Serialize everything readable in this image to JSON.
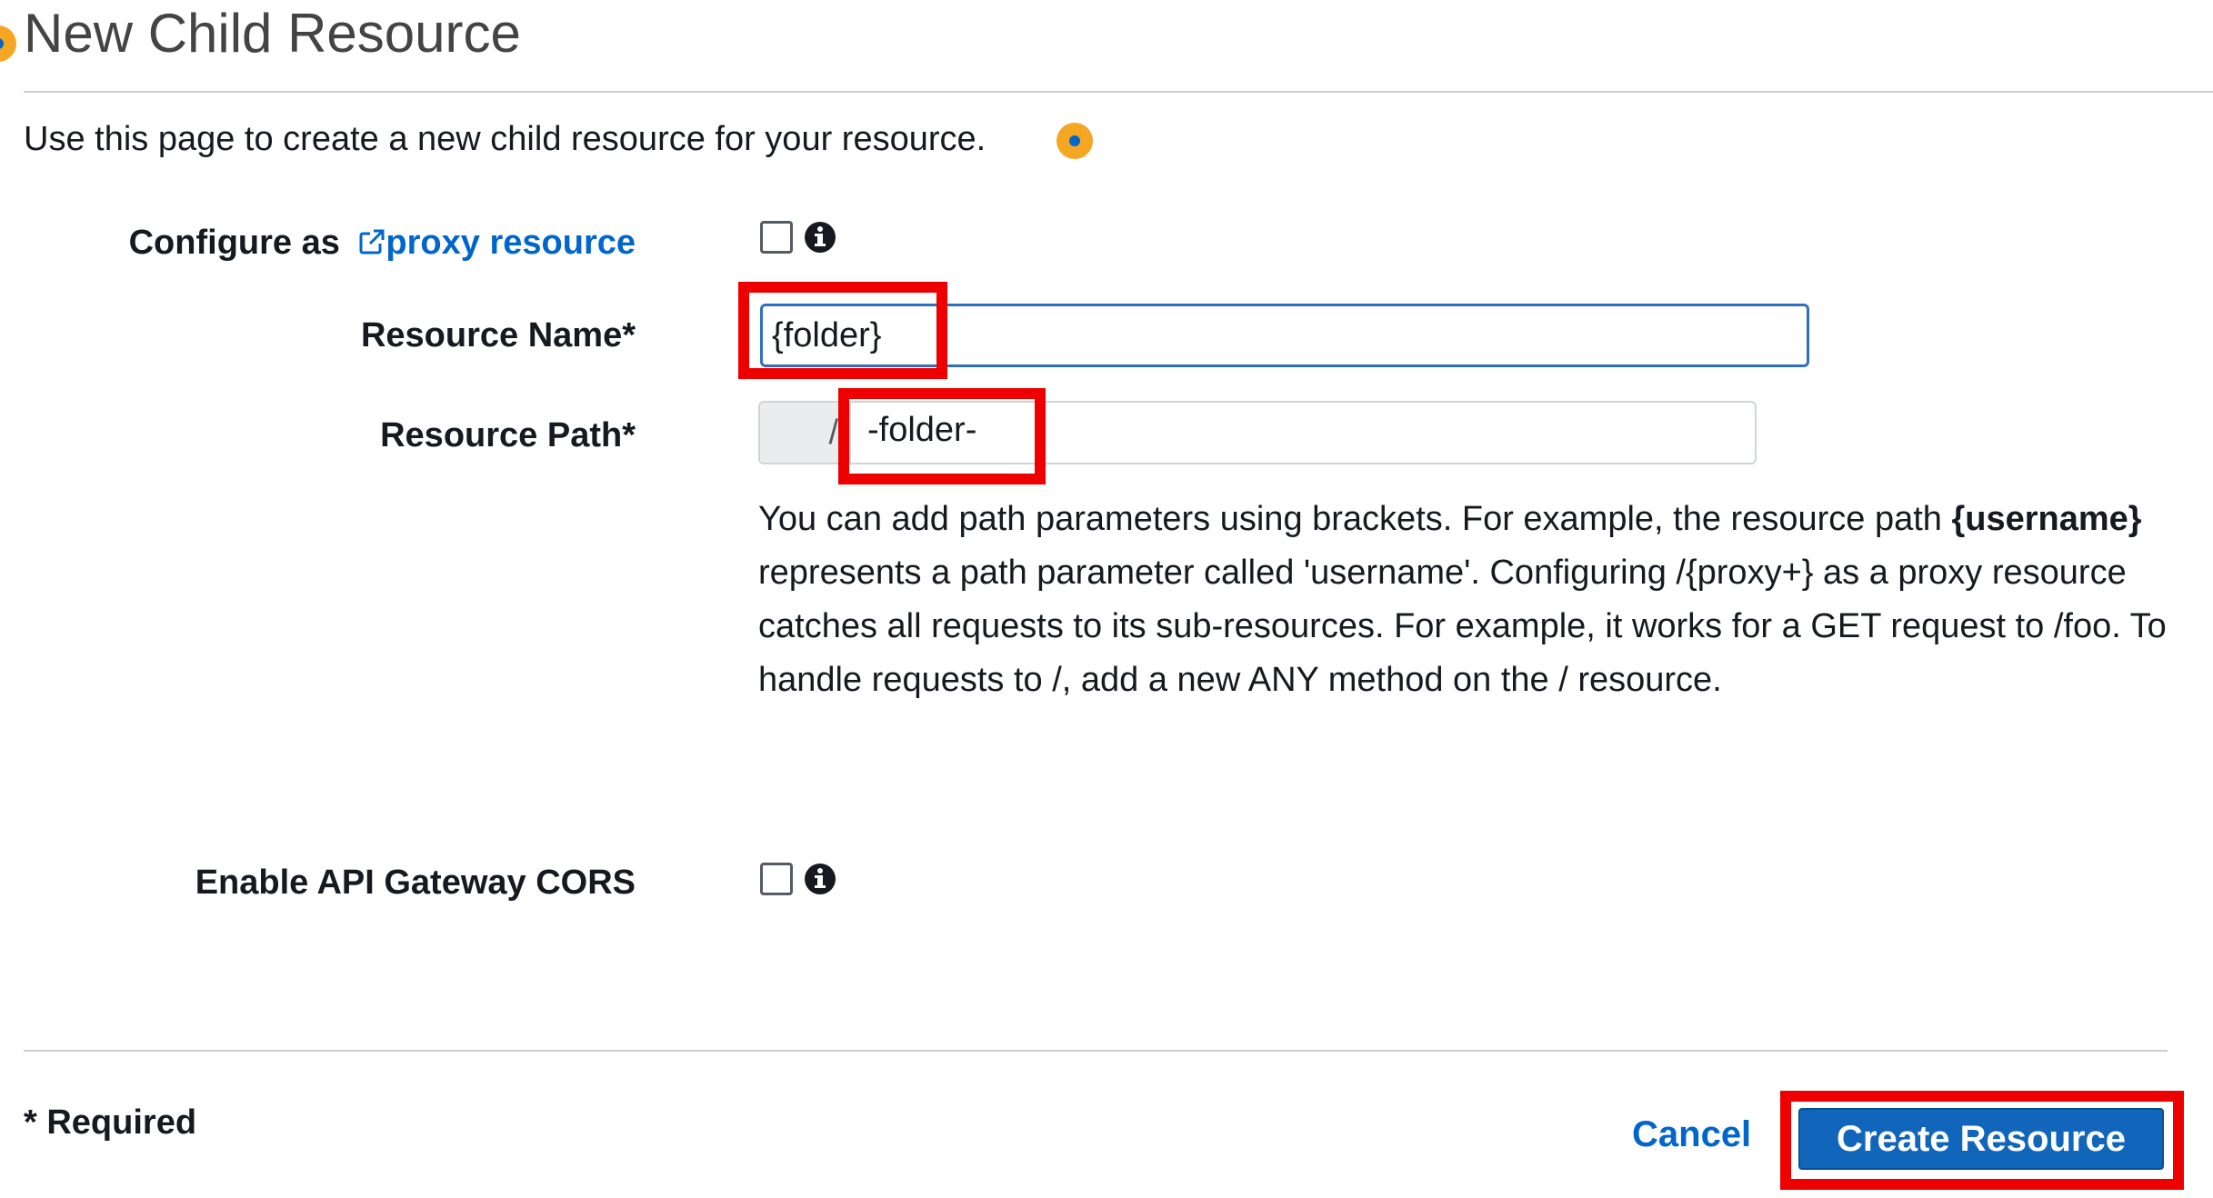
{
  "header": {
    "title": "New Child Resource",
    "subtitle": "Use this page to create a new child resource for your resource."
  },
  "form": {
    "proxy": {
      "label_prefix": "Configure as ",
      "link_text": "proxy resource",
      "checked": false
    },
    "resource_name": {
      "label": "Resource Name*",
      "value": "{folder}"
    },
    "resource_path": {
      "label": "Resource Path*",
      "prefix": "/",
      "value": "-folder-"
    },
    "help": {
      "part1": "You can add path parameters using brackets. For example, the resource path ",
      "bold": "{username}",
      "part2": " represents a path parameter called 'username'. Configuring /{proxy+} as a proxy resource catches all requests to its sub-resources. For example, it works for a GET request to /foo. To handle requests to /, add a new ANY method on the / resource."
    },
    "cors": {
      "label": "Enable API Gateway CORS",
      "checked": false
    }
  },
  "footer": {
    "required_note": "* Required",
    "cancel_label": "Cancel",
    "create_label": "Create Resource"
  },
  "colors": {
    "link": "#0066cc",
    "primary_button": "#1166bb",
    "annotation": "#ee0000",
    "info_dot": "#f5a623"
  },
  "icons": {
    "external_link": "external-link-icon",
    "info": "info-icon",
    "help_dot": "help-dot-icon"
  }
}
